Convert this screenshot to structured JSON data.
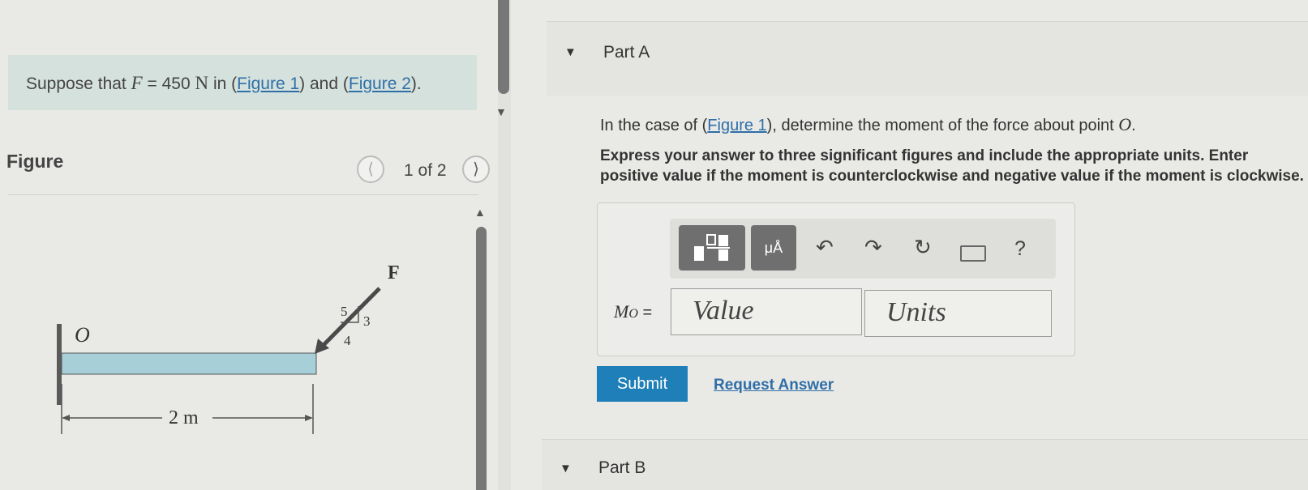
{
  "intro": {
    "prefix": "Suppose that ",
    "force_var": "F",
    "equals_value": " = 450 ",
    "unit": "N",
    "in_text": " in (",
    "figure1_link": "Figure 1",
    "and_text": ") and (",
    "figure2_link": "Figure 2",
    "suffix": ")."
  },
  "figure_panel": {
    "title": "Figure",
    "counter": "1 of 2",
    "prev_icon": "chevron-left-icon",
    "next_icon": "chevron-right-icon"
  },
  "figure": {
    "point_label": "O",
    "force_label": "F",
    "slope_hyp": "5",
    "slope_vert": "3",
    "slope_horiz": "4",
    "length_label": "2 m",
    "beam_color": "#a7cfd8",
    "force_color": "#4a4a4a"
  },
  "partA": {
    "label": "Part A",
    "question_prefix": "In the case of (",
    "question_link": "Figure 1",
    "question_suffix": "), determine the moment of the force about point ",
    "question_point": "O",
    "question_end": ".",
    "instruction": "Express your answer to three significant figures and include the appropriate units. Enter positive value if the moment is counterclockwise and negative value if the moment is clockwise.",
    "toolbar": {
      "templates_icon": "templates-icon",
      "symbols_label": "μÅ",
      "undo_icon": "undo-icon",
      "redo_icon": "redo-icon",
      "reset_icon": "reset-icon",
      "keyboard_icon": "keyboard-icon",
      "help_label": "?"
    },
    "answer_var": "M",
    "answer_sub": "O",
    "answer_eq": " =",
    "value_placeholder": "Value",
    "units_placeholder": "Units",
    "submit_label": "Submit",
    "request_answer_label": "Request Answer"
  },
  "partB": {
    "label": "Part B"
  },
  "colors": {
    "intro_bg": "#d5e1dc",
    "link": "#2f6fa8",
    "submit_bg": "#1f7fb8",
    "toolbar_dark": "#6f6f6f"
  }
}
